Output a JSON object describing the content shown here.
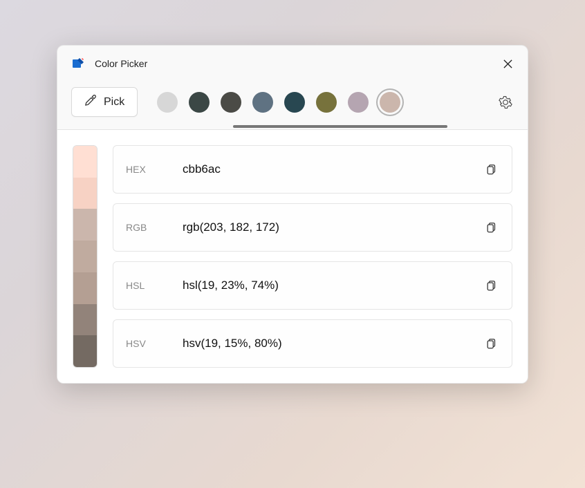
{
  "window": {
    "title": "Color Picker"
  },
  "toolbar": {
    "pick_label": "Pick",
    "swatches": [
      {
        "color": "#d7d7d7",
        "selected": false
      },
      {
        "color": "#3b4745",
        "selected": false
      },
      {
        "color": "#4b4b46",
        "selected": false
      },
      {
        "color": "#5f7282",
        "selected": false
      },
      {
        "color": "#284751",
        "selected": false
      },
      {
        "color": "#77723c",
        "selected": false
      },
      {
        "color": "#b5a5b1",
        "selected": false
      },
      {
        "color": "#cbb6ac",
        "selected": true
      }
    ]
  },
  "shades": [
    "#ffdfd3",
    "#f7d2c4",
    "#cbb6ac",
    "#c0ab9f",
    "#b49f93",
    "#92837a",
    "#746a62"
  ],
  "formats": [
    {
      "label": "HEX",
      "value": "cbb6ac"
    },
    {
      "label": "RGB",
      "value": "rgb(203, 182, 172)"
    },
    {
      "label": "HSL",
      "value": "hsl(19, 23%, 74%)"
    },
    {
      "label": "HSV",
      "value": "hsv(19, 15%, 80%)"
    }
  ]
}
